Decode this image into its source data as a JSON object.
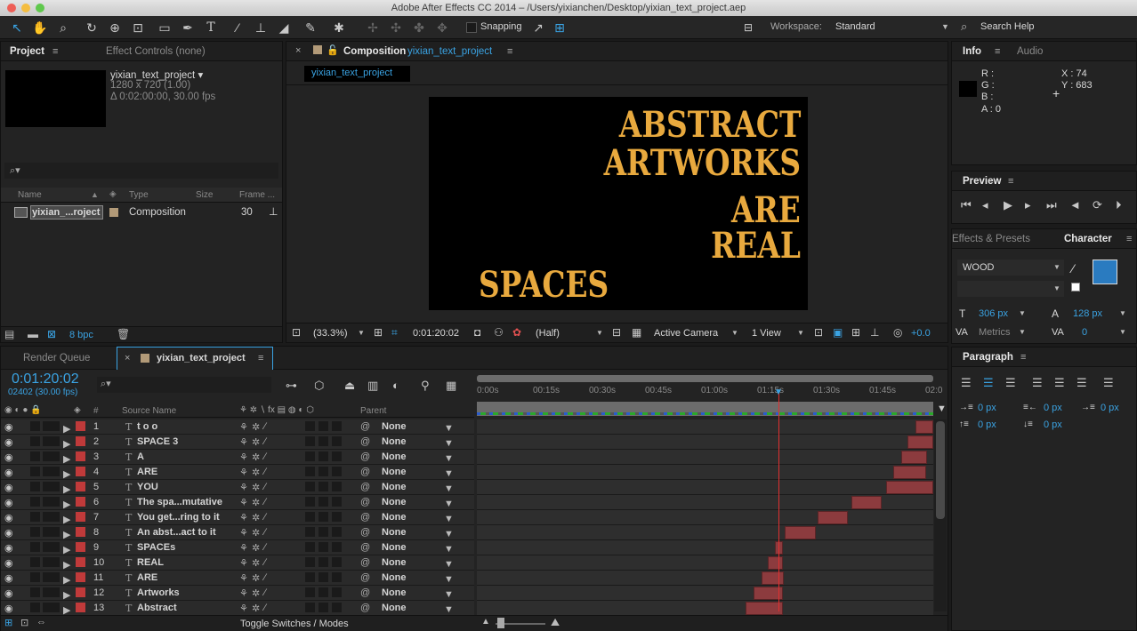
{
  "window_title": "Adobe After Effects CC 2014 – /Users/yixianchen/Desktop/yixian_text_project.aep",
  "toolbar": {
    "snapping_label": "Snapping",
    "workspace_label": "Workspace:",
    "workspace_value": "Standard",
    "search_help": "Search Help"
  },
  "project_panel": {
    "tab_project": "Project",
    "tab_effect_controls": "Effect Controls (none)",
    "comp_name": "yixian_text_project ▾",
    "comp_size": "1280 x 720 (1.00)",
    "comp_duration": "Δ 0:02:00:00, 30.00 fps",
    "search_icon": "⌕▾",
    "col_name": "Name",
    "col_type": "Type",
    "col_size": "Size",
    "col_frame": "Frame ...",
    "item_name": "yixian_...roject",
    "item_type": "Composition",
    "item_frame": "30",
    "bpc": "8 bpc"
  },
  "composition_panel": {
    "tab_label": "Composition",
    "tab_comp_name": "yixian_text_project",
    "sub_tab": "yixian_text_project",
    "canvas_text": [
      "ABSTRACT",
      "ARTWORKS",
      "ARE",
      "REAL",
      "SPACES"
    ],
    "zoom": "(33.3%)",
    "timecode": "0:01:20:02",
    "resolution": "(Half)",
    "camera": "Active Camera",
    "views": "1 View",
    "exposure": "+0.0"
  },
  "info_panel": {
    "tab_info": "Info",
    "tab_audio": "Audio",
    "r": "R :",
    "g": "G :",
    "b": "B :",
    "a": "A : 0",
    "x": "X : 74",
    "y": "Y : 683"
  },
  "preview_panel": {
    "tab": "Preview"
  },
  "character_panel": {
    "tab_effects": "Effects & Presets",
    "tab_character": "Character",
    "font": "WOOD",
    "font_size": "306 px",
    "leading": "128 px",
    "kerning": "Metrics",
    "tracking": "0",
    "fill_color": "#2a7bc0"
  },
  "paragraph_panel": {
    "tab": "Paragraph",
    "indent_left": "0 px",
    "indent_right": "0 px",
    "indent_first": "0 px",
    "space_before": "0 px",
    "space_after": "0 px"
  },
  "timeline": {
    "tab_render_queue": "Render Queue",
    "tab_comp": "yixian_text_project",
    "timecode": "0:01:20:02",
    "frame_info": "02402 (30.00 fps)",
    "col_number": "#",
    "col_source": "Source Name",
    "col_parent": "Parent",
    "ruler": [
      "0:00s",
      "00:15s",
      "00:30s",
      "00:45s",
      "01:00s",
      "01:15s",
      "01:30s",
      "01:45s",
      "02:0"
    ],
    "toggle_label": "Toggle Switches / Modes",
    "layers": [
      {
        "num": "1",
        "name": "t o o",
        "parent": "None"
      },
      {
        "num": "2",
        "name": "SPACE 3",
        "parent": "None"
      },
      {
        "num": "3",
        "name": "A",
        "parent": "None"
      },
      {
        "num": "4",
        "name": "ARE",
        "parent": "None"
      },
      {
        "num": "5",
        "name": "YOU",
        "parent": "None"
      },
      {
        "num": "6",
        "name": "The spa...mutative",
        "parent": "None"
      },
      {
        "num": "7",
        "name": "You get...ring to it",
        "parent": "None"
      },
      {
        "num": "8",
        "name": "An abst...act to it",
        "parent": "None"
      },
      {
        "num": "9",
        "name": "SPACEs",
        "parent": "None"
      },
      {
        "num": "10",
        "name": "REAL",
        "parent": "None"
      },
      {
        "num": "11",
        "name": "ARE",
        "parent": "None"
      },
      {
        "num": "12",
        "name": "Artworks",
        "parent": "None"
      },
      {
        "num": "13",
        "name": "Abstract",
        "parent": "None"
      }
    ]
  }
}
